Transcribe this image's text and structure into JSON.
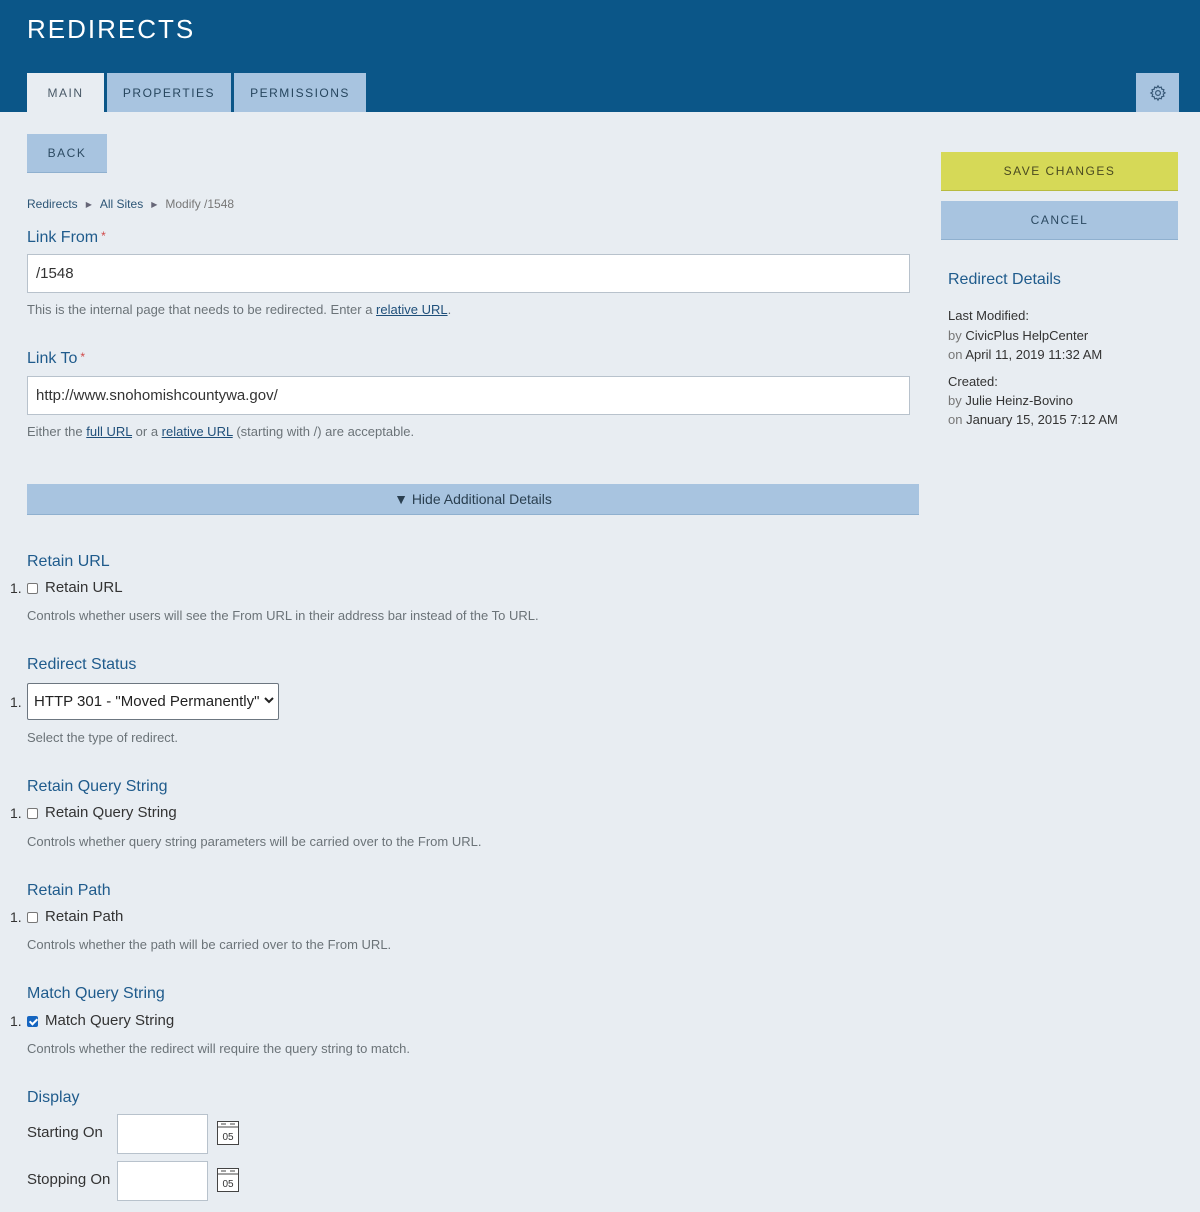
{
  "header": {
    "title": "REDIRECTS",
    "tabs": [
      {
        "label": "MAIN"
      },
      {
        "label": "PROPERTIES"
      },
      {
        "label": "PERMISSIONS"
      }
    ]
  },
  "actions": {
    "back_label": "BACK",
    "save_label": "SAVE CHANGES",
    "cancel_label": "CANCEL"
  },
  "breadcrumb": {
    "items": [
      "Redirects",
      "All Sites"
    ],
    "current": "Modify /1548"
  },
  "form": {
    "link_from": {
      "label": "Link From",
      "required": "*",
      "value": "/1548",
      "help_prefix": "This is the internal page that needs to be redirected. Enter a ",
      "help_link": "relative URL",
      "help_suffix": "."
    },
    "link_to": {
      "label": "Link To",
      "required": "*",
      "value": "http://www.snohomishcountywa.gov/",
      "help_prefix": "Either the ",
      "help_link1": "full URL",
      "help_mid": " or a ",
      "help_link2": "relative URL",
      "help_suffix": " (starting with /) are acceptable."
    },
    "toggle_label": "▼ Hide Additional Details",
    "list_number": "1.",
    "retain_url": {
      "heading": "Retain URL",
      "checkbox_label": "Retain URL",
      "checked": false,
      "help": "Controls whether users will see the From URL in their address bar instead of the To URL."
    },
    "redirect_status": {
      "heading": "Redirect Status",
      "selected": "HTTP 301 - \"Moved Permanently\"",
      "help": "Select the type of redirect."
    },
    "retain_query_string": {
      "heading": "Retain Query String",
      "checkbox_label": "Retain Query String",
      "checked": false,
      "help": "Controls whether query string parameters will be carried over to the From URL."
    },
    "retain_path": {
      "heading": "Retain Path",
      "checkbox_label": "Retain Path",
      "checked": false,
      "help": "Controls whether the path will be carried over to the From URL."
    },
    "match_query_string": {
      "heading": "Match Query String",
      "checkbox_label": "Match Query String",
      "checked": true,
      "help": "Controls whether the redirect will require the query string to match."
    },
    "display": {
      "heading": "Display",
      "starting_label": "Starting On",
      "stopping_label": "Stopping On",
      "starting_value": "",
      "stopping_value": "",
      "calendar_day": "05"
    }
  },
  "details": {
    "title": "Redirect Details",
    "modified_label": "Last Modified:",
    "by": "by",
    "on": "on",
    "modified_by": "CivicPlus HelpCenter",
    "modified_on": "April 11, 2019 11:32 AM",
    "created_label": "Created:",
    "created_by": "Julie Heinz-Bovino",
    "created_on": "January 15, 2015 7:12 AM"
  },
  "colors": {
    "header_bg": "#0b5688",
    "tab_bg": "#a8c4e0",
    "page_bg": "#e8edf2",
    "save_bg": "#d6d957",
    "heading": "#1f5b8c"
  },
  "icons": [
    "gear-icon",
    "calendar-icon",
    "chevron-down-icon",
    "checkbox-icon"
  ]
}
